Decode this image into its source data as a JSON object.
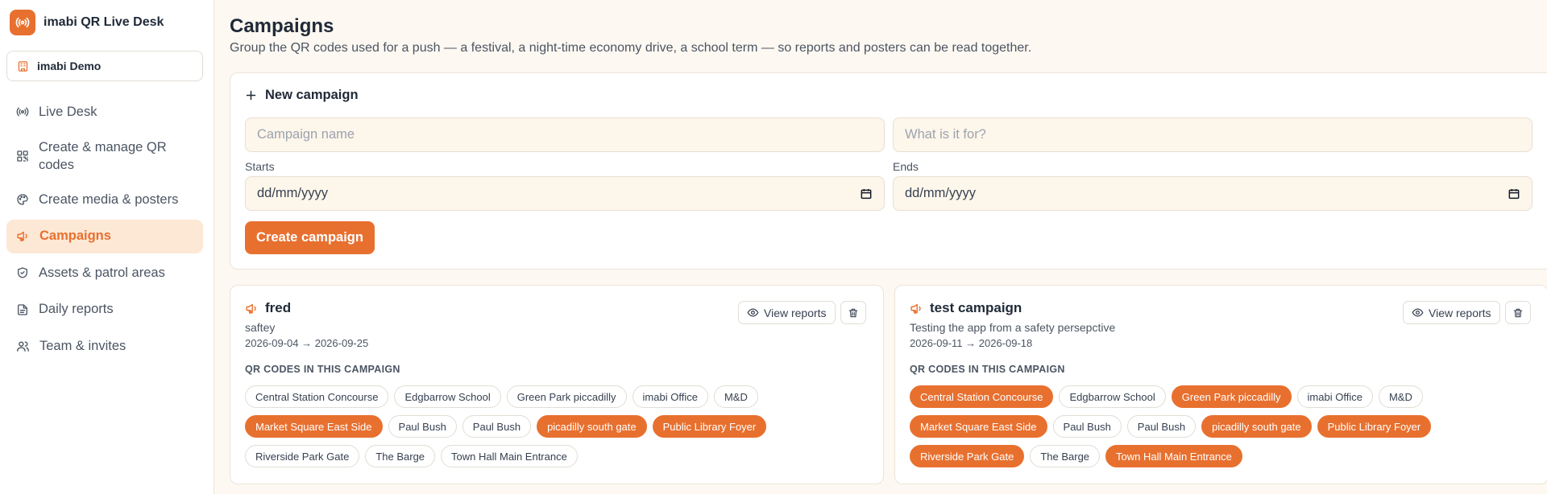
{
  "app": {
    "title": "imabi QR Live Desk"
  },
  "org": {
    "name": "imabi Demo"
  },
  "nav": [
    {
      "label": "Live Desk",
      "icon": "broadcast-icon",
      "active": false
    },
    {
      "label": "Create & manage QR codes",
      "icon": "qr-code-icon",
      "active": false
    },
    {
      "label": "Create media & posters",
      "icon": "palette-icon",
      "active": false
    },
    {
      "label": "Campaigns",
      "icon": "megaphone-icon",
      "active": true
    },
    {
      "label": "Assets & patrol areas",
      "icon": "shield-check-icon",
      "active": false
    },
    {
      "label": "Daily reports",
      "icon": "document-icon",
      "active": false
    },
    {
      "label": "Team & invites",
      "icon": "users-icon",
      "active": false
    }
  ],
  "page": {
    "title": "Campaigns",
    "subtitle": "Group the QR codes used for a push — a festival, a night-time economy drive, a school term — so reports and posters can be read together."
  },
  "new_campaign": {
    "heading": "New campaign",
    "name_placeholder": "Campaign name",
    "purpose_placeholder": "What is it for?",
    "starts_label": "Starts",
    "ends_label": "Ends",
    "date_placeholder": "dd/mm/yyyy",
    "create_label": "Create campaign"
  },
  "labels": {
    "view_reports": "View reports",
    "qr_codes_heading": "QR CODES IN THIS CAMPAIGN"
  },
  "campaigns": [
    {
      "name": "fred",
      "purpose": "saftey",
      "dates": "2026-09-04 → 2026-09-25",
      "chips": [
        {
          "label": "Central Station Concourse",
          "selected": false
        },
        {
          "label": "Edgbarrow School",
          "selected": false
        },
        {
          "label": "Green Park piccadilly",
          "selected": false
        },
        {
          "label": "imabi Office",
          "selected": false
        },
        {
          "label": "M&D",
          "selected": false
        },
        {
          "label": "Market Square East Side",
          "selected": true
        },
        {
          "label": "Paul Bush",
          "selected": false
        },
        {
          "label": "Paul Bush",
          "selected": false
        },
        {
          "label": "picadilly south gate",
          "selected": true
        },
        {
          "label": "Public Library Foyer",
          "selected": true
        },
        {
          "label": "Riverside Park Gate",
          "selected": false
        },
        {
          "label": "The Barge",
          "selected": false
        },
        {
          "label": "Town Hall Main Entrance",
          "selected": false
        }
      ]
    },
    {
      "name": "test campaign",
      "purpose": "Testing the app from a safety persepctive",
      "dates": "2026-09-11 → 2026-09-18",
      "chips": [
        {
          "label": "Central Station Concourse",
          "selected": true
        },
        {
          "label": "Edgbarrow School",
          "selected": false
        },
        {
          "label": "Green Park piccadilly",
          "selected": true
        },
        {
          "label": "imabi Office",
          "selected": false
        },
        {
          "label": "M&D",
          "selected": false
        },
        {
          "label": "Market Square East Side",
          "selected": true
        },
        {
          "label": "Paul Bush",
          "selected": false
        },
        {
          "label": "Paul Bush",
          "selected": false
        },
        {
          "label": "picadilly south gate",
          "selected": true
        },
        {
          "label": "Public Library Foyer",
          "selected": true
        },
        {
          "label": "Riverside Park Gate",
          "selected": true
        },
        {
          "label": "The Barge",
          "selected": false
        },
        {
          "label": "Town Hall Main Entrance",
          "selected": true
        }
      ]
    }
  ],
  "colors": {
    "accent": "#e8702f",
    "accent_soft": "#fde8d6",
    "page_bg": "#fdf8f1"
  }
}
